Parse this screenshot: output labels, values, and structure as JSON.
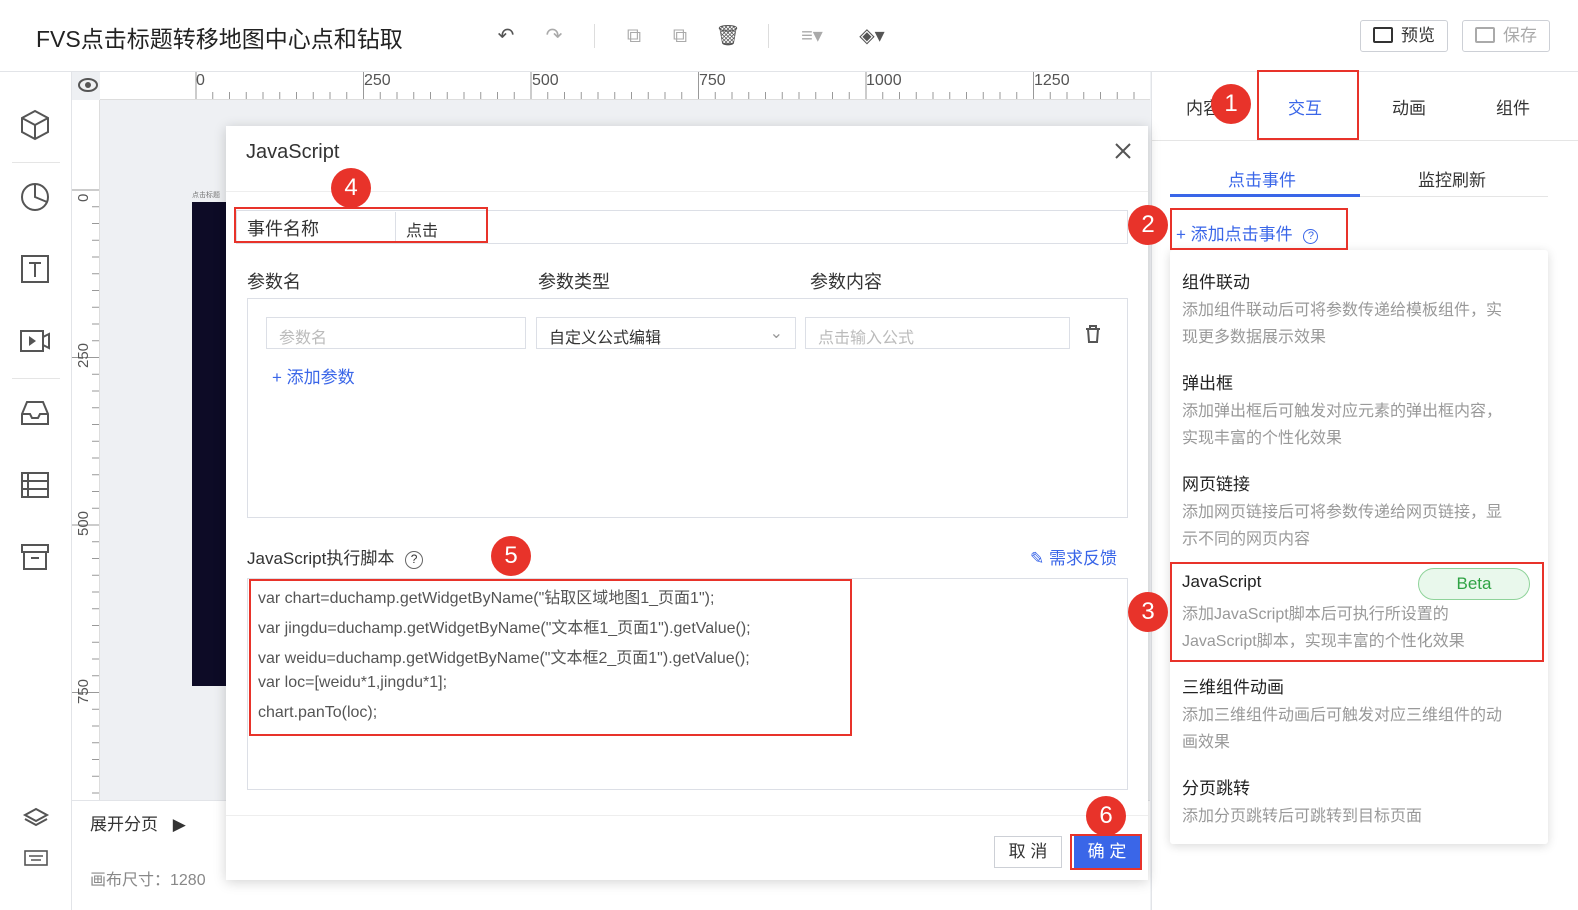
{
  "header": {
    "title": "FVS点击标题转移地图中心点和钻取",
    "preview_label": "预览",
    "save_label": "保存"
  },
  "ruler": {
    "top_labels": [
      "0",
      "250",
      "500",
      "750",
      "1000",
      "1250"
    ],
    "left_labels": [
      "0",
      "250",
      "500",
      "750"
    ]
  },
  "canvas": {
    "expand_label": "展开分页",
    "size_text": "画布尺寸：1280",
    "dark_widget_text": "点击标题"
  },
  "right_panel": {
    "tabs": [
      "内容",
      "交互",
      "动画",
      "组件"
    ],
    "active_tab": "交互",
    "subtabs": [
      "点击事件",
      "监控刷新"
    ],
    "add_click_event": "+ 添加点击事件",
    "menu": [
      {
        "title": "组件联动",
        "desc": "添加组件联动后可将参数传递给模板组件，实现更多数据展示效果"
      },
      {
        "title": "弹出框",
        "desc": "添加弹出框后可触发对应元素的弹出框内容，实现丰富的个性化效果"
      },
      {
        "title": "网页链接",
        "desc": "添加网页链接后可将参数传递给网页链接，显示不同的网页内容"
      },
      {
        "title": "JavaScript",
        "desc": "添加JavaScript脚本后可执行所设置的JavaScript脚本，实现丰富的个性化效果",
        "badge": "Beta"
      },
      {
        "title": "三维组件动画",
        "desc": "添加三维组件动画后可触发对应三维组件的动画效果"
      },
      {
        "title": "分页跳转",
        "desc": "添加分页跳转后可跳转到目标页面"
      }
    ]
  },
  "dialog": {
    "title": "JavaScript",
    "event_name_label": "事件名称",
    "event_name_value": "点击",
    "param_headers": [
      "参数名",
      "参数类型",
      "参数内容"
    ],
    "param_name_placeholder": "参数名",
    "param_type_value": "自定义公式编辑",
    "param_content_placeholder": "点击输入公式",
    "add_param": "+ 添加参数",
    "js_label": "JavaScript执行脚本",
    "feedback": "需求反馈",
    "code_lines": [
      "var chart=duchamp.getWidgetByName(\"钻取区域地图1_页面1\");",
      "var jingdu=duchamp.getWidgetByName(\"文本框1_页面1\").getValue();",
      "var weidu=duchamp.getWidgetByName(\"文本框2_页面1\").getValue();",
      "var loc=[weidu*1,jingdu*1];",
      "chart.panTo(loc);"
    ],
    "cancel": "取 消",
    "ok": "确 定"
  },
  "annotations": [
    "1",
    "2",
    "3",
    "4",
    "5",
    "6"
  ],
  "colors": {
    "accent": "#3a66e8",
    "annotation": "#e8332a",
    "beta_green": "#2fa344"
  }
}
